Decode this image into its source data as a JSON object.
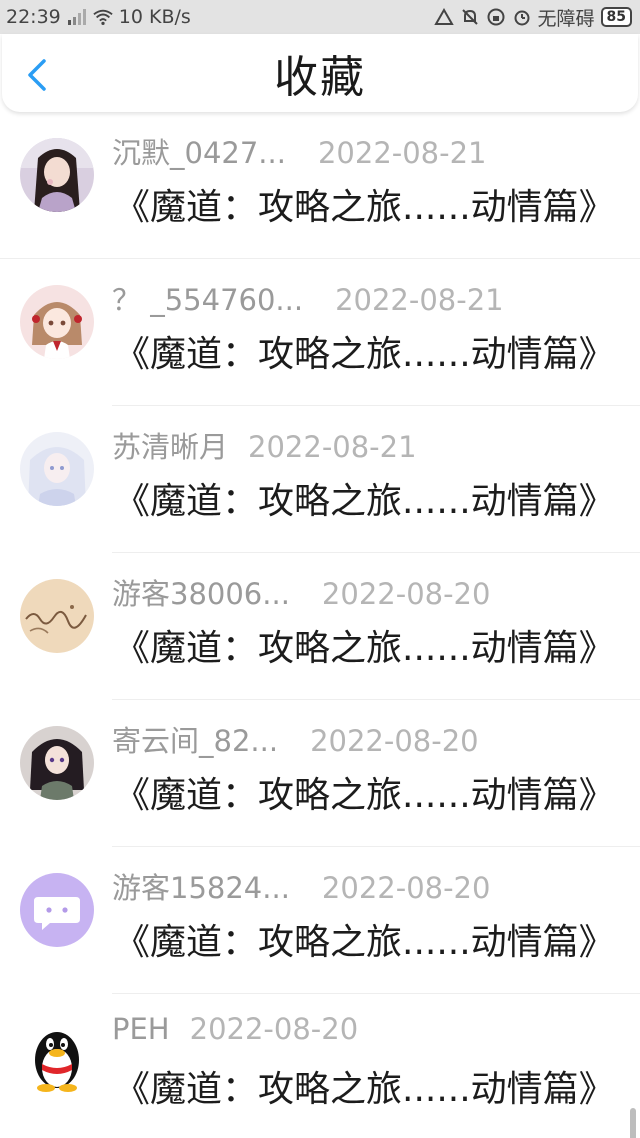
{
  "status_bar": {
    "time": "22:39",
    "net_speed": "10 KB/s",
    "accessibility": "无障碍",
    "battery": "85"
  },
  "header": {
    "title": "收藏",
    "back_icon": "chevron-left-icon"
  },
  "items": [
    {
      "user": "沉默_0427...",
      "date": "2022-08-21",
      "book": "《魔道：攻略之旅......动情篇》",
      "avatar": "girl-portrait"
    },
    {
      "user": "？ _554760...",
      "date": "2022-08-21",
      "book": "《魔道：攻略之旅......动情篇》",
      "avatar": "anime-girl"
    },
    {
      "user": "苏清晰月",
      "date": "2022-08-21",
      "book": "《魔道：攻略之旅......动情篇》",
      "avatar": "white-hair-girl"
    },
    {
      "user": "游客38006...",
      "date": "2022-08-20",
      "book": "《魔道：攻略之旅......动情篇》",
      "avatar": "sand-writing"
    },
    {
      "user": "寄云间_82...",
      "date": "2022-08-20",
      "book": "《魔道：攻略之旅......动情篇》",
      "avatar": "dark-anime-girl"
    },
    {
      "user": "游客15824...",
      "date": "2022-08-20",
      "book": "《魔道：攻略之旅......动情篇》",
      "avatar": "chat-bubble"
    },
    {
      "user": "PEH",
      "date": "2022-08-20",
      "book": "《魔道：攻略之旅......动情篇》",
      "avatar": "penguin"
    }
  ],
  "colors": {
    "accent": "#2a9df4",
    "status_bar_bg": "#e3e3e3",
    "meta_text": "#9a9a9a"
  }
}
